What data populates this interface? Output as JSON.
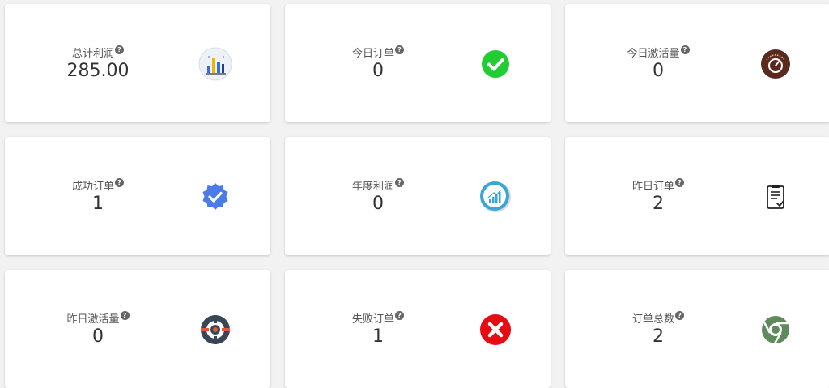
{
  "cards": [
    {
      "label": "总计利润",
      "value": "285.00",
      "icon": "bar-chart-icon",
      "help": "?"
    },
    {
      "label": "今日订单",
      "value": "0",
      "icon": "green-check-icon",
      "help": "?"
    },
    {
      "label": "今日激活量",
      "value": "0",
      "icon": "gauge-icon",
      "help": "?"
    },
    {
      "label": "成功订单",
      "value": "1",
      "icon": "verified-badge-icon",
      "help": "?"
    },
    {
      "label": "年度利润",
      "value": "0",
      "icon": "growth-chart-icon",
      "help": "?"
    },
    {
      "label": "昨日订单",
      "value": "2",
      "icon": "clipboard-check-icon",
      "help": "?"
    },
    {
      "label": "昨日激活量",
      "value": "0",
      "icon": "lifebuoy-icon",
      "help": "?"
    },
    {
      "label": "失败订单",
      "value": "1",
      "icon": "red-x-icon",
      "help": "?"
    },
    {
      "label": "订单总数",
      "value": "2",
      "icon": "chrome-icon",
      "help": "?"
    }
  ],
  "colors": {
    "background": "#f2f2f2",
    "card": "#ffffff",
    "success": "#22c55e",
    "danger": "#e11d1d",
    "gauge": "#5a2a1f",
    "badge": "#4a7be8",
    "growth": "#3aa6d8",
    "lifebuoy": "#3a4656",
    "chrome": "#5f8a5b"
  }
}
